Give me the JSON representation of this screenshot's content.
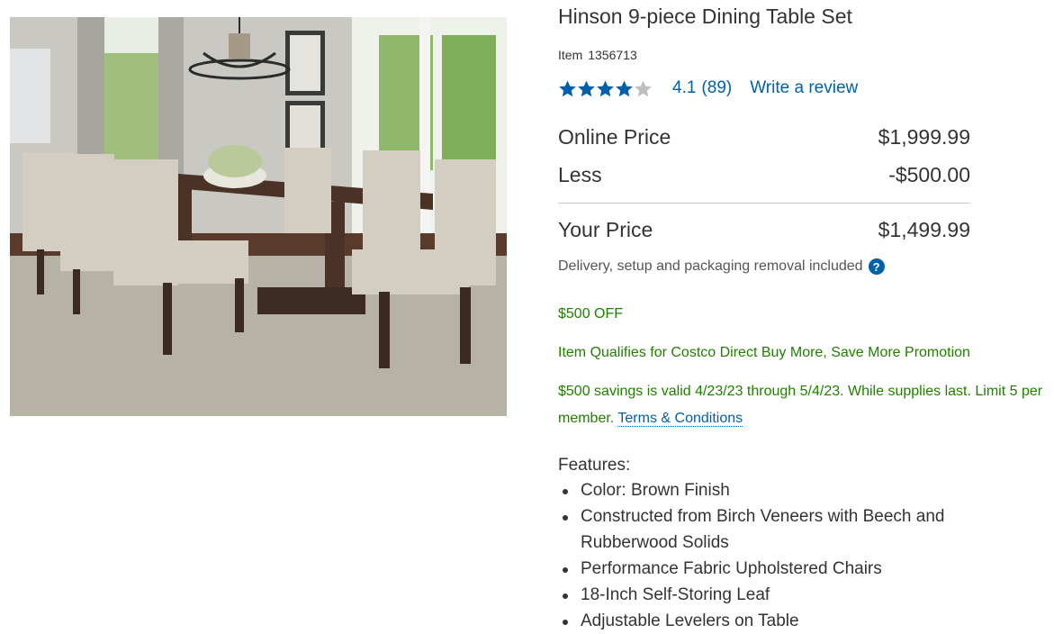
{
  "product": {
    "title": "Hinson 9-piece Dining Table Set",
    "item_label": "Item",
    "item_number": "1356713",
    "rating": {
      "value": 4.1,
      "value_text": "4.1",
      "count_text": "(89)",
      "stars_max": 5,
      "write_review": "Write a review"
    },
    "pricing": {
      "online_label": "Online Price",
      "online_value": "$1,999.99",
      "less_label": "Less",
      "less_value": "-$500.00",
      "your_label": "Your Price",
      "your_value": "$1,499.99"
    },
    "delivery_text": "Delivery, setup and packaging removal included",
    "help_icon": "?",
    "promo": {
      "off": "$500 OFF",
      "qualifies": "Item Qualifies for Costco Direct Buy More, Save More Promotion",
      "valid": "$500 savings is valid 4/23/23 through 5/4/23. While supplies last. Limit 5 per member.",
      "terms": "Terms & Conditions"
    },
    "features_title": "Features:",
    "features": [
      "Color: Brown Finish",
      "Constructed from Birch Veneers with Beech and Rubberwood Solids",
      "Performance Fabric Upholstered Chairs",
      "18-Inch Self-Storing Leaf",
      "Adjustable Levelers on Table"
    ]
  },
  "colors": {
    "link": "#0060a9",
    "promo": "#218000",
    "star": "#0060a9",
    "star_empty": "#bfbfbf",
    "text": "#333333"
  },
  "icons": {
    "help": "question-circle-icon",
    "star": "star-icon"
  }
}
